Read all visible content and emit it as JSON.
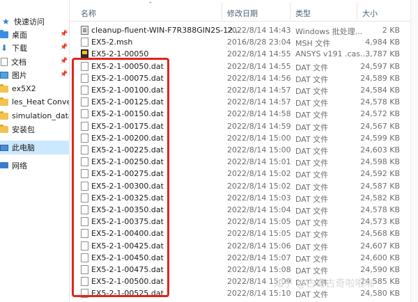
{
  "sidebar": {
    "items": [
      {
        "label": "快速访问",
        "icon": "star-icon",
        "pinned": false,
        "selected": false
      },
      {
        "label": "桌面",
        "icon": "desktop-folder-icon",
        "pinned": true,
        "selected": false
      },
      {
        "label": "下载",
        "icon": "download-icon",
        "pinned": true,
        "selected": false
      },
      {
        "label": "文档",
        "icon": "documents-icon",
        "pinned": true,
        "selected": false
      },
      {
        "label": "图片",
        "icon": "pictures-icon",
        "pinned": true,
        "selected": false
      },
      {
        "label": "ex5X2",
        "icon": "folder-icon",
        "pinned": false,
        "selected": false
      },
      {
        "label": "les_Heat Convectio",
        "icon": "folder-icon",
        "pinned": false,
        "selected": false
      },
      {
        "label": "simulation_data",
        "icon": "folder-icon",
        "pinned": false,
        "selected": false
      },
      {
        "label": "安装包",
        "icon": "folder-icon",
        "pinned": false,
        "selected": false
      },
      {
        "label": "此电脑",
        "icon": "this-pc-icon",
        "pinned": false,
        "selected": true
      },
      {
        "label": "网络",
        "icon": "network-icon",
        "pinned": false,
        "selected": false
      }
    ]
  },
  "header": {
    "name": "名称",
    "date": "修改日期",
    "type": "类型",
    "size": "大小"
  },
  "files": [
    {
      "name": "cleanup-fluent-WIN-F7R388GIN2S-12...",
      "date": "2022/8/14 14:43",
      "type": "Windows 批处理...",
      "size": "2 KB",
      "icon": "batch-file-icon"
    },
    {
      "name": "EX5-2.msh",
      "date": "2016/8/28 23:04",
      "type": "MSH 文件",
      "size": "4,984 KB",
      "icon": "file-icon"
    },
    {
      "name": "EX5-2-1-00050",
      "date": "2022/8/14 14:55",
      "type": "ANSYS v191 .cas...",
      "size": "3,787 KB",
      "icon": "ansys-file-icon"
    },
    {
      "name": "EX5-2-1-00050.dat",
      "date": "2022/8/14 14:55",
      "type": "DAT 文件",
      "size": "24,597 KB",
      "icon": "file-icon"
    },
    {
      "name": "EX5-2-1-00075.dat",
      "date": "2022/8/14 14:56",
      "type": "DAT 文件",
      "size": "24,589 KB",
      "icon": "file-icon"
    },
    {
      "name": "EX5-2-1-00100.dat",
      "date": "2022/8/14 14:57",
      "type": "DAT 文件",
      "size": "24,584 KB",
      "icon": "file-icon"
    },
    {
      "name": "EX5-2-1-00125.dat",
      "date": "2022/8/14 14:57",
      "type": "DAT 文件",
      "size": "24,578 KB",
      "icon": "file-icon"
    },
    {
      "name": "EX5-2-1-00150.dat",
      "date": "2022/8/14 14:58",
      "type": "DAT 文件",
      "size": "24,572 KB",
      "icon": "file-icon"
    },
    {
      "name": "EX5-2-1-00175.dat",
      "date": "2022/8/14 14:59",
      "type": "DAT 文件",
      "size": "24,567 KB",
      "icon": "file-icon"
    },
    {
      "name": "EX5-2-1-00200.dat",
      "date": "2022/8/14 15:00",
      "type": "DAT 文件",
      "size": "24,599 KB",
      "icon": "file-icon"
    },
    {
      "name": "EX5-2-1-00225.dat",
      "date": "2022/8/14 15:00",
      "type": "DAT 文件",
      "size": "24,603 KB",
      "icon": "file-icon"
    },
    {
      "name": "EX5-2-1-00250.dat",
      "date": "2022/8/14 15:01",
      "type": "DAT 文件",
      "size": "24,598 KB",
      "icon": "file-icon"
    },
    {
      "name": "EX5-2-1-00275.dat",
      "date": "2022/8/14 15:02",
      "type": "DAT 文件",
      "size": "24,592 KB",
      "icon": "file-icon"
    },
    {
      "name": "EX5-2-1-00300.dat",
      "date": "2022/8/14 15:02",
      "type": "DAT 文件",
      "size": "24,587 KB",
      "icon": "file-icon"
    },
    {
      "name": "EX5-2-1-00325.dat",
      "date": "2022/8/14 15:03",
      "type": "DAT 文件",
      "size": "24,582 KB",
      "icon": "file-icon"
    },
    {
      "name": "EX5-2-1-00350.dat",
      "date": "2022/8/14 15:04",
      "type": "DAT 文件",
      "size": "24,578 KB",
      "icon": "file-icon"
    },
    {
      "name": "EX5-2-1-00375.dat",
      "date": "2022/8/14 15:05",
      "type": "DAT 文件",
      "size": "24,573 KB",
      "icon": "file-icon"
    },
    {
      "name": "EX5-2-1-00400.dat",
      "date": "2022/8/14 15:05",
      "type": "DAT 文件",
      "size": "24,568 KB",
      "icon": "file-icon"
    },
    {
      "name": "EX5-2-1-00425.dat",
      "date": "2022/8/14 15:06",
      "type": "DAT 文件",
      "size": "24,607 KB",
      "icon": "file-icon"
    },
    {
      "name": "EX5-2-1-00450.dat",
      "date": "2022/8/14 15:07",
      "type": "DAT 文件",
      "size": "24,600 KB",
      "icon": "file-icon"
    },
    {
      "name": "EX5-2-1-00475.dat",
      "date": "2022/8/14 15:08",
      "type": "DAT 文件",
      "size": "24,590 KB",
      "icon": "file-icon"
    },
    {
      "name": "EX5-2-1-00500.dat",
      "date": "2022/8/14 15:09",
      "type": "DAT 文件",
      "size": "24,585 KB",
      "icon": "file-icon"
    },
    {
      "name": "EX5-2-1-00525.dat",
      "date": "2022/8/14 15:10",
      "type": "DAT 文件",
      "size": "24,580 KB",
      "icon": "file-icon"
    }
  ],
  "watermark": "知乎 @古奇古奇啦啦啦",
  "annotation": {
    "color": "#e1251b"
  },
  "colors": {
    "selected": "#cce8ff",
    "header_text": "#4c607a",
    "meta_text": "#6d6d6d"
  }
}
